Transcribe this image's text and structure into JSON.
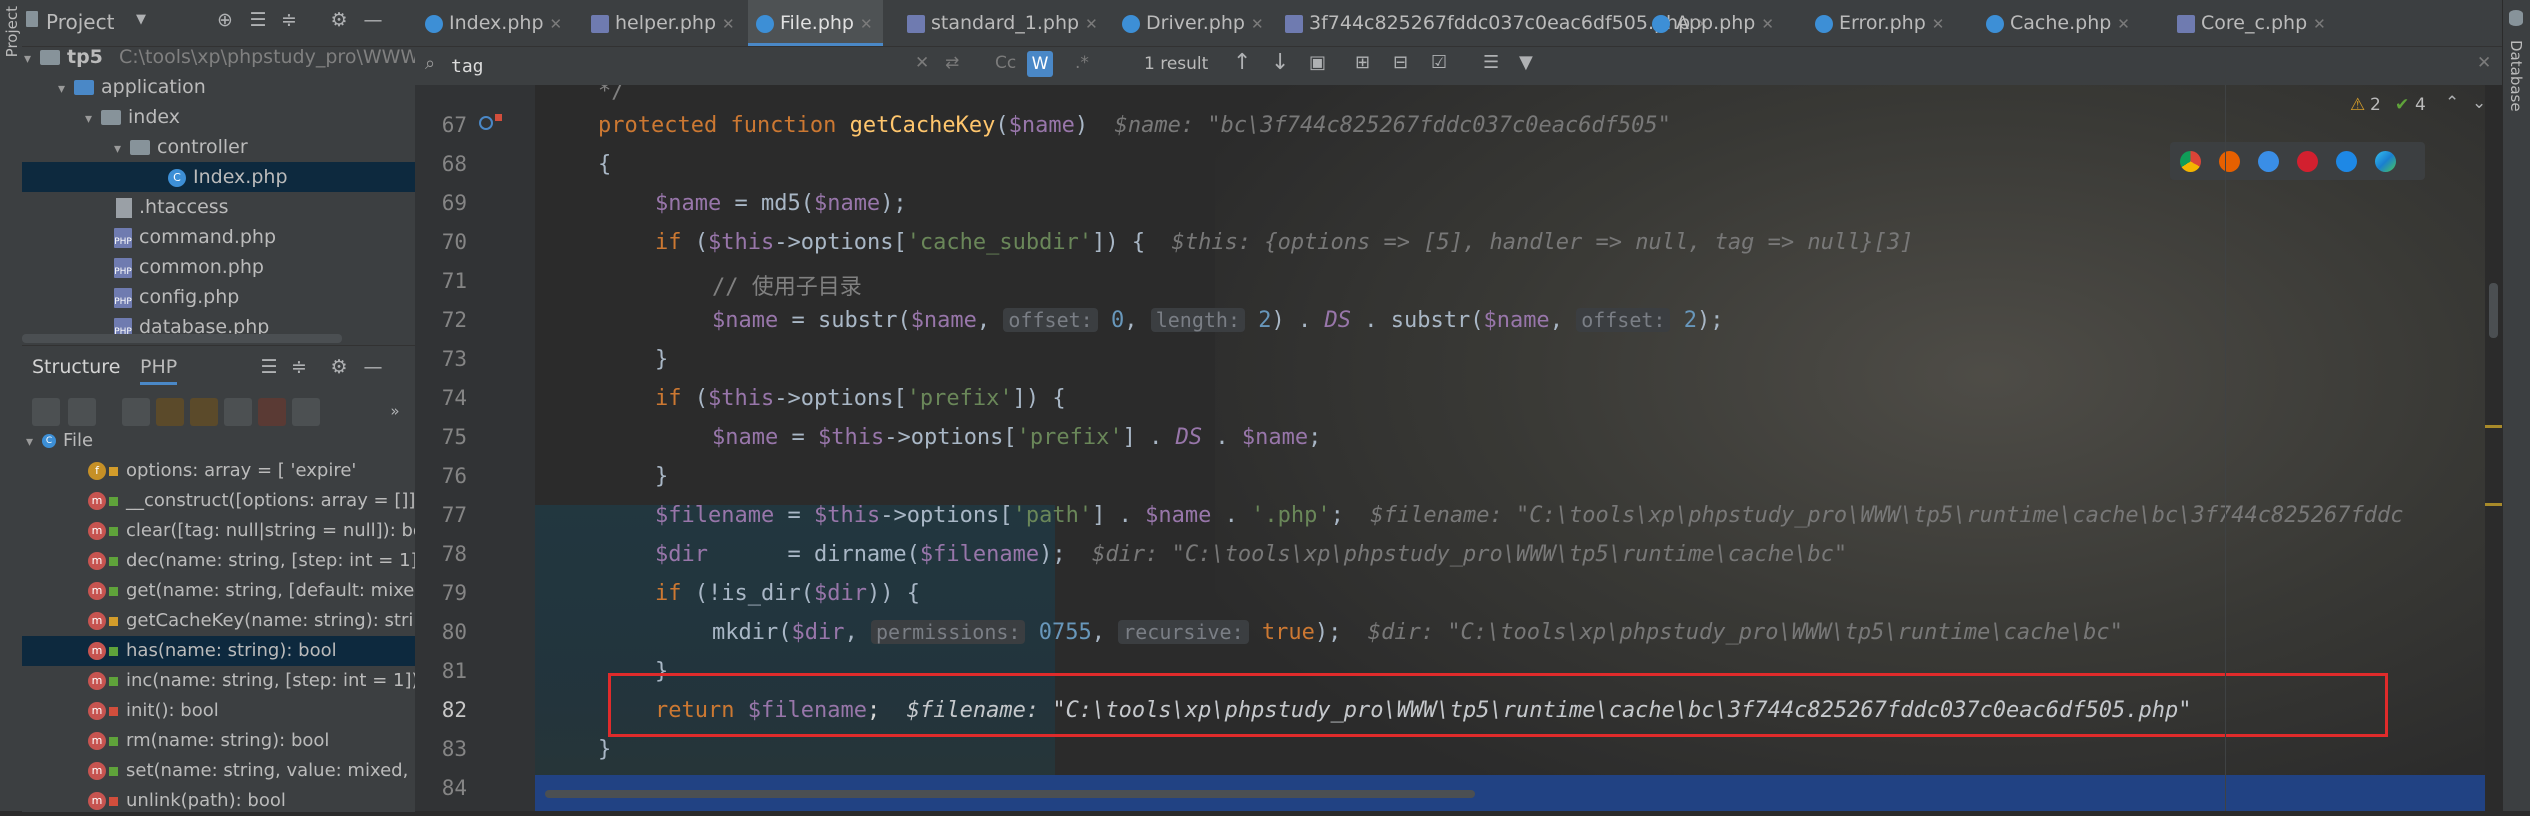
{
  "left_strip": {
    "label": "Project"
  },
  "right_strip": {
    "label": "Database"
  },
  "project": {
    "title": "Project",
    "tree": [
      {
        "name": "tp5",
        "extra": "C:\\tools\\xp\\phpstudy_pro\\WWW\\tp5"
      },
      {
        "name": "application"
      },
      {
        "name": "index"
      },
      {
        "name": "controller"
      },
      {
        "name": "Index.php"
      },
      {
        "name": ".htaccess"
      },
      {
        "name": "command.php"
      },
      {
        "name": "common.php"
      },
      {
        "name": "config.php"
      },
      {
        "name": "database.php"
      }
    ]
  },
  "structure": {
    "tabs": [
      "Structure",
      "PHP"
    ],
    "class_name": "File",
    "members": [
      "options: array = [ 'expire'",
      "__construct([options: array = []])",
      "clear([tag: null|string = null]): bo",
      "dec(name: string, [step: int = 1])",
      "get(name: string, [default: mixed",
      "getCacheKey(name: string): strin",
      "has(name: string): bool",
      "inc(name: string, [step: int = 1]):",
      "init(): bool",
      "rm(name: string): bool",
      "set(name: string, value: mixed, [e",
      "unlink(path): bool"
    ]
  },
  "tabs": [
    "Index.php",
    "helper.php",
    "File.php",
    "standard_1.php",
    "Driver.php",
    "3f744c825267fddc037c0eac6df505.php",
    "App.php",
    "Error.php",
    "Cache.php",
    "Core_c.php"
  ],
  "find": {
    "query": "tag",
    "results": "1 result",
    "opt_cc": "Cc",
    "opt_w": "W",
    "opt_regex": ".*"
  },
  "inspections": {
    "warnings": "2",
    "ok": "4"
  },
  "code": {
    "lines": [
      "67",
      "68",
      "69",
      "70",
      "71",
      "72",
      "73",
      "74",
      "75",
      "76",
      "77",
      "78",
      "79",
      "80",
      "81",
      "82",
      "83",
      "84"
    ],
    "l66_top": "*/",
    "l67_kw": "protected function",
    "l67_fn": "getCacheKey",
    "l67_param": "$name",
    "l67_hint": "$name: \"bc\\3f744c825267fddc037c0eac6df505\"",
    "l69_var": "$name",
    "l69_rest": " = md5(",
    "l69_var2": "$name",
    "l69_end": ");",
    "l70_if": "if",
    "l70_this": "$this",
    "l70_key": "'cache_subdir'",
    "l70_hint": "$this: {options => [5], handler => null, tag => null}[3]",
    "l71_cmt": "// 使用子目录",
    "l72_var": "$name",
    "l72_hint_offset": "offset:",
    "l72_zero": "0",
    "l72_hint_len": "length:",
    "l72_two": "2",
    "l72_ds": "DS",
    "l72_var2": "$name",
    "l72_hint_offset2": "offset:",
    "l72_two2": "2",
    "l74_this": "$this",
    "l74_key": "'prefix'",
    "l75_var": "$name",
    "l75_this": "$this",
    "l75_key": "'prefix'",
    "l75_ds": "DS",
    "l75_var2": "$name",
    "l77_var": "$filename",
    "l77_this": "$this",
    "l77_key": "'path'",
    "l77_var2": "$name",
    "l77_ext": "'.php'",
    "l77_hint": "$filename: \"C:\\tools\\xp\\phpstudy_pro\\WWW\\tp5\\runtime\\cache\\bc\\3f744c825267fddc",
    "l78_var": "$dir",
    "l78_fn": "dirname(",
    "l78_var2": "$filename",
    "l78_hint": "$dir: \"C:\\tools\\xp\\phpstudy_pro\\WWW\\tp5\\runtime\\cache\\bc\"",
    "l79_if": "if",
    "l79_fn": "(!is_dir(",
    "l79_var": "$dir",
    "l80_fn": "mkdir(",
    "l80_var": "$dir",
    "l80_hint_perm": "permissions:",
    "l80_num": "0755",
    "l80_hint_rec": "recursive:",
    "l80_true": "true",
    "l80_hint": "$dir: \"C:\\tools\\xp\\phpstudy_pro\\WWW\\tp5\\runtime\\cache\\bc\"",
    "l82_ret": "return",
    "l82_var": "$filename",
    "l82_hint": "$filename: \"C:\\tools\\xp\\phpstudy_pro\\WWW\\tp5\\runtime\\cache\\bc\\3f744c825267fddc037c0eac6df505.php\""
  },
  "colors": {
    "accent": "#4a88c7",
    "highlight": "#214283",
    "box": "#e02b2b"
  }
}
